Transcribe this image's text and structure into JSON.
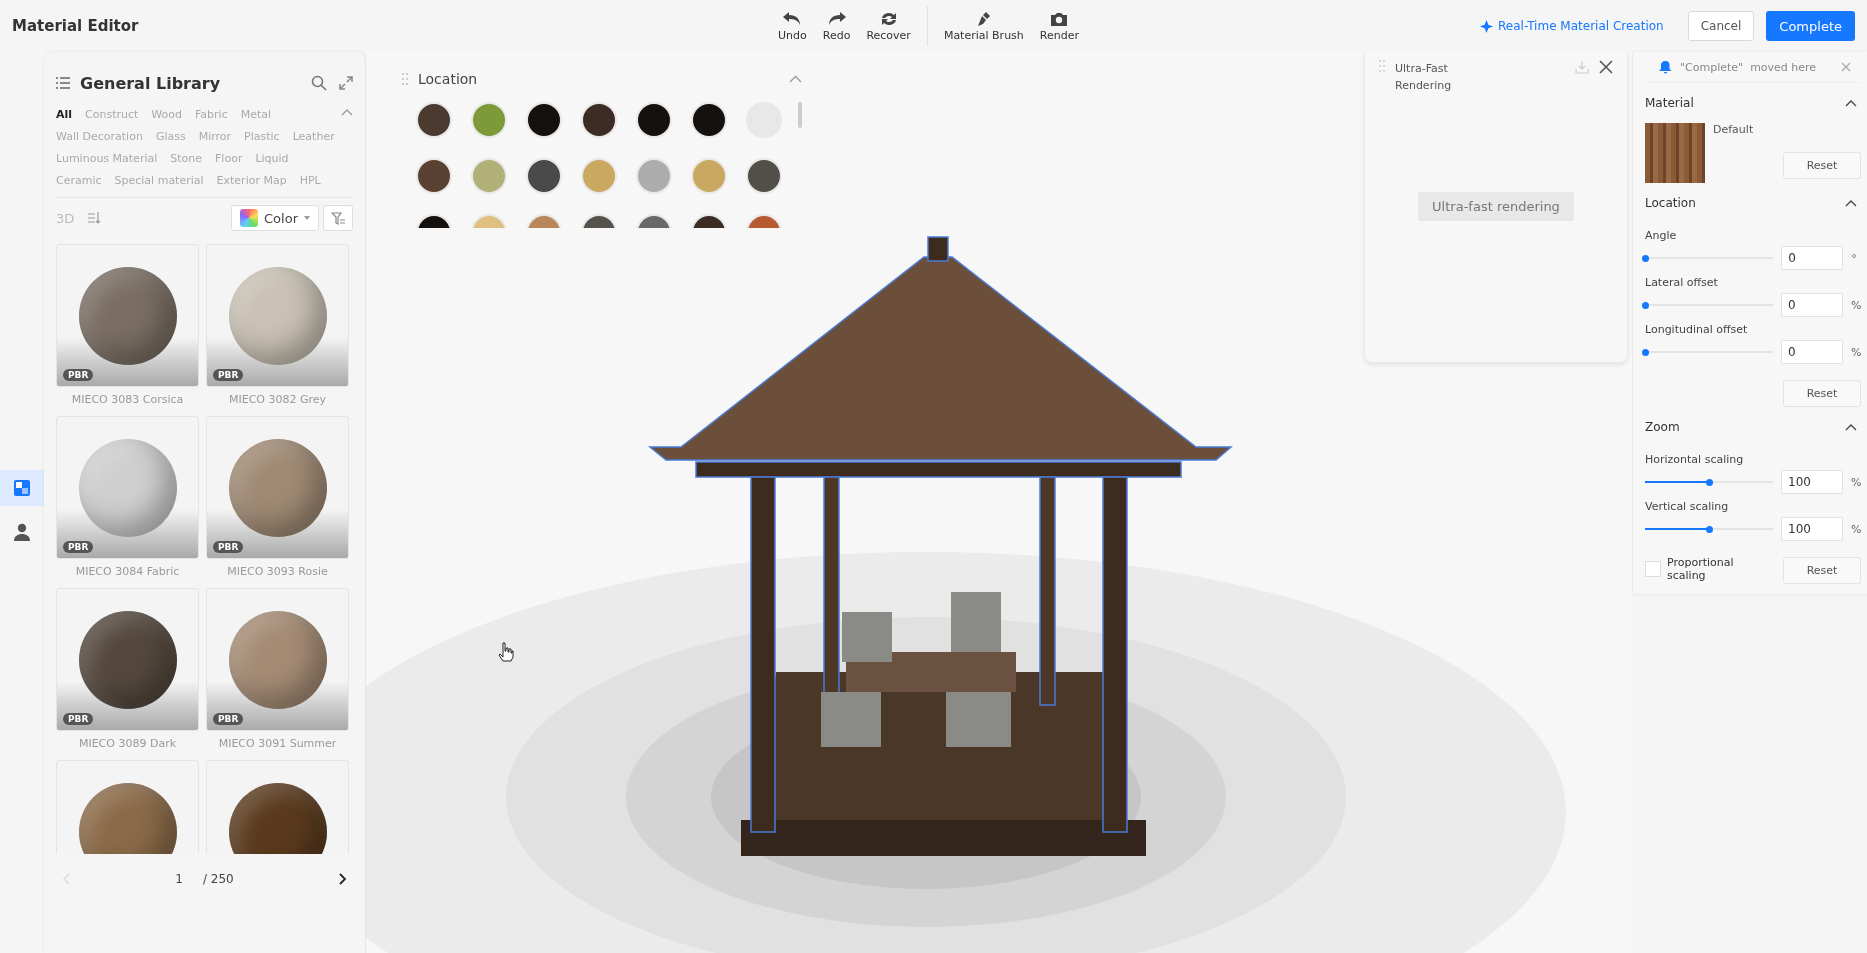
{
  "app": {
    "title": "Material Editor"
  },
  "toolbar": [
    {
      "kind": "undo",
      "label": "Undo"
    },
    {
      "kind": "redo",
      "label": "Redo"
    },
    {
      "kind": "recover",
      "label": "Recover"
    },
    {
      "kind": "brush",
      "label": "Material Brush"
    },
    {
      "kind": "render",
      "label": "Render"
    }
  ],
  "top_actions": {
    "link": "Real-Time Material Creation",
    "cancel": "Cancel",
    "complete": "Complete"
  },
  "rail": [
    {
      "kind": "library",
      "selected": true
    },
    {
      "kind": "user",
      "selected": false
    }
  ],
  "library": {
    "title": "General Library",
    "tags": [
      {
        "label": "All",
        "selected": true
      },
      {
        "label": "Construct",
        "selected": false
      },
      {
        "label": "Wood",
        "selected": false
      },
      {
        "label": "Fabric",
        "selected": false
      },
      {
        "label": "Metal",
        "selected": false
      },
      {
        "label": "Wall Decoration",
        "selected": false
      },
      {
        "label": "Glass",
        "selected": false
      },
      {
        "label": "Mirror",
        "selected": false
      },
      {
        "label": "Plastic",
        "selected": false
      },
      {
        "label": "Leather",
        "selected": false
      },
      {
        "label": "Luminous Material",
        "selected": false
      },
      {
        "label": "Stone",
        "selected": false
      },
      {
        "label": "Floor",
        "selected": false
      },
      {
        "label": "Liquid",
        "selected": false
      },
      {
        "label": "Ceramic",
        "selected": false
      },
      {
        "label": "Special material",
        "selected": false
      },
      {
        "label": "Exterior Map",
        "selected": false
      },
      {
        "label": "HPL",
        "selected": false
      }
    ],
    "view_toggle": "3D",
    "color_filter": "Color",
    "items": [
      {
        "name": "MIECO 3083 Corsica",
        "badge": "PBR",
        "color": "#7a6e63"
      },
      {
        "name": "MIECO 3082 Grey",
        "badge": "PBR",
        "color": "#c9c1b3"
      },
      {
        "name": "MIECO 3084 Fabric",
        "badge": "PBR",
        "color": "#cfcfcf"
      },
      {
        "name": "MIECO 3093 Rosie",
        "badge": "PBR",
        "color": "#a08a74"
      },
      {
        "name": "MIECO 3089 Dark",
        "badge": "PBR",
        "color": "#54483e"
      },
      {
        "name": "MIECO 3091 Summer",
        "badge": "PBR",
        "color": "#a58b74"
      },
      {
        "color": "#8a6a48"
      },
      {
        "color": "#5a3a1e"
      }
    ],
    "pagination": {
      "page": "1",
      "total": "/ 250",
      "prev_disabled": true
    }
  },
  "location_panel": {
    "title": "Location",
    "swatches": [
      {
        "color": "#4a3a30"
      },
      {
        "color": "#7d9a3a"
      },
      {
        "color": "#15110e"
      },
      {
        "color": "#3c2c24"
      },
      {
        "color": "#15110e"
      },
      {
        "color": "#15110e"
      },
      {
        "color": "#e8e8e8"
      },
      {
        "color": "#5a4030"
      },
      {
        "color": "#b0b078"
      },
      {
        "color": "#4a4a4a"
      },
      {
        "color": "#c9a860"
      },
      {
        "color": "#acacac"
      },
      {
        "color": "#c9a860"
      },
      {
        "color": "#524e48"
      },
      {
        "color": "#15110e"
      },
      {
        "color": "#e0c080"
      },
      {
        "color": "#b8885a"
      },
      {
        "color": "#55524c"
      },
      {
        "color": "#68696b"
      },
      {
        "color": "#3c2c24"
      },
      {
        "color": "#b85a30"
      }
    ]
  },
  "render_panel": {
    "title": "Ultra-Fast Rendering",
    "button": "Ultra-fast rendering"
  },
  "properties": {
    "notice": "\"Complete\"  moved here",
    "material": {
      "title": "Material",
      "name": "Default",
      "reset": "Reset"
    },
    "location": {
      "title": "Location",
      "sliders": [
        {
          "label": "Angle",
          "level": 0,
          "value": "0",
          "unit": "°"
        },
        {
          "label": "Lateral offset",
          "level": 0,
          "value": "0",
          "unit": "%"
        },
        {
          "label": "Longitudinal offset",
          "level": 0,
          "value": "0",
          "unit": "%"
        }
      ],
      "reset": "Reset"
    },
    "zoom": {
      "title": "Zoom",
      "sliders": [
        {
          "label": "Horizontal scaling",
          "level": 0.5,
          "value": "100",
          "unit": "%"
        },
        {
          "label": "Vertical scaling",
          "level": 0.5,
          "value": "100",
          "unit": "%"
        }
      ],
      "proportional": {
        "label": "Proportional scaling",
        "checked": false
      },
      "reset": "Reset"
    }
  }
}
